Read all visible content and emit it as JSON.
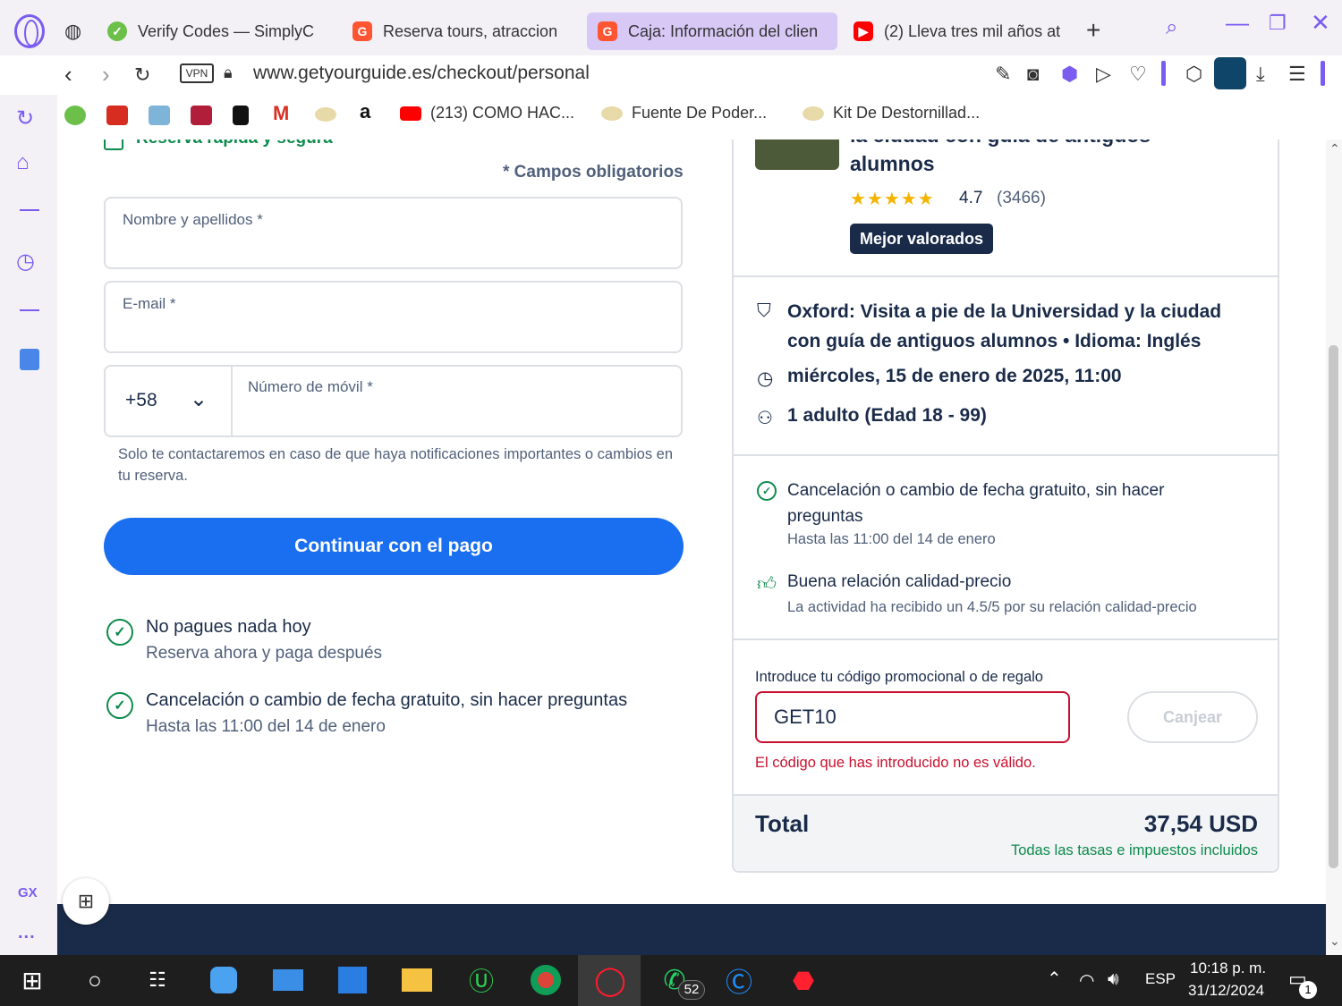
{
  "browser": {
    "tabs": [
      {
        "label": "Verify Codes — SimplyC",
        "fav_color": "#6cc04a"
      },
      {
        "label": "Reserva tours, atraccion",
        "fav_color": "#ff5533"
      },
      {
        "label": "Caja: Información del clien",
        "fav_color": "#ff5533"
      },
      {
        "label": "(2) Lleva tres mil años at",
        "fav_color": "#ff0000"
      }
    ],
    "vpn_label": "VPN",
    "url": "www.getyourguide.es/checkout/personal",
    "bookmarks": [
      {
        "label": "(213) COMO HAC...",
        "color": "#ff0000"
      },
      {
        "label": "Fuente De Poder...",
        "color": "#e8d9a8"
      },
      {
        "label": "Kit De Destornillad...",
        "color": "#e8d9a8"
      }
    ],
    "gx_label": "GX",
    "dots_label": "..."
  },
  "form": {
    "heading_partial": "Reserva rápida y segura",
    "required_note": "* Campos obligatorios",
    "name_label": "Nombre y apellidos *",
    "email_label": "E-mail *",
    "country_code": "+58",
    "phone_label": "Número de móvil *",
    "contact_note": "Solo te contactaremos en caso de que haya notificaciones importantes o cambios en tu reserva.",
    "continue_button": "Continuar con el pago",
    "benefits": [
      {
        "title": "No pagues nada hoy",
        "subtitle": "Reserva ahora y paga después"
      },
      {
        "title": "Cancelación o cambio de fecha gratuito, sin hacer preguntas",
        "subtitle": "Hasta las 11:00 del 14 de enero"
      }
    ]
  },
  "summary": {
    "tour_title_partial": "la ciudad con guía de antiguos",
    "tour_title_end": "alumnos",
    "rating": "4.7",
    "reviews": "(3466)",
    "rating_value": 4.7,
    "badge": "Mejor valorados",
    "details": {
      "activity": "Oxford: Visita a pie de la Universidad y la ciudad con guía de antiguos alumnos • Idioma: Inglés",
      "date": "miércoles, 15 de enero de 2025, 11:00",
      "participants": "1 adulto (Edad 18 - 99)"
    },
    "features": [
      {
        "title": "Cancelación o cambio de fecha gratuito, sin hacer preguntas",
        "subtitle": "Hasta las 11:00 del 14 de enero"
      },
      {
        "title": "Buena relación calidad-precio",
        "subtitle": "La actividad ha recibido un 4.5/5 por su relación calidad-precio"
      }
    ],
    "promo_label": "Introduce tu código promocional o de regalo",
    "promo_value": "GET10",
    "promo_button": "Canjear",
    "promo_error": "El código que has introducido no es válido.",
    "total_label": "Total",
    "total_value": "37,54 USD",
    "total_note": "Todas las tasas e impuestos incluidos"
  },
  "taskbar": {
    "whatsapp_badge": "52",
    "lang": "ESP",
    "time": "10:18 p. m.",
    "date": "31/12/2024",
    "notif_badge": "1"
  },
  "colors": {
    "primary_button": "#1a6ff0",
    "error": "#c8102e",
    "success": "#0d8a4c",
    "navy": "#1a2b49",
    "opera_purple": "#7b5cf0"
  }
}
